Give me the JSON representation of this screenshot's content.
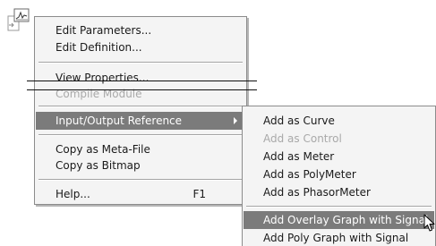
{
  "context_menu": {
    "items": [
      {
        "label": "Edit Parameters..."
      },
      {
        "label": "Edit Definition..."
      },
      {
        "label": "View Properties..."
      },
      {
        "label": "Compile Module"
      },
      {
        "label": "Input/Output Reference"
      },
      {
        "label": "Copy as Meta-File"
      },
      {
        "label": "Copy as Bitmap"
      },
      {
        "label": "Help...",
        "shortcut": "F1"
      }
    ]
  },
  "submenu": {
    "items": [
      {
        "label": "Add as Curve"
      },
      {
        "label": "Add as Control"
      },
      {
        "label": "Add as Meter"
      },
      {
        "label": "Add as PolyMeter"
      },
      {
        "label": "Add as PhasorMeter"
      },
      {
        "label": "Add Overlay Graph with Signal"
      },
      {
        "label": "Add Poly Graph with Signal"
      }
    ]
  },
  "colors": {
    "menu_background": "#f4f4f4",
    "highlight": "#7b7b7b",
    "disabled_text": "#a9a9a9"
  },
  "icons": {
    "graph_component": "graph-component-icon",
    "submenu_arrow": "chevron-right-icon",
    "mouse_pointer": "arrow-cursor-icon"
  }
}
